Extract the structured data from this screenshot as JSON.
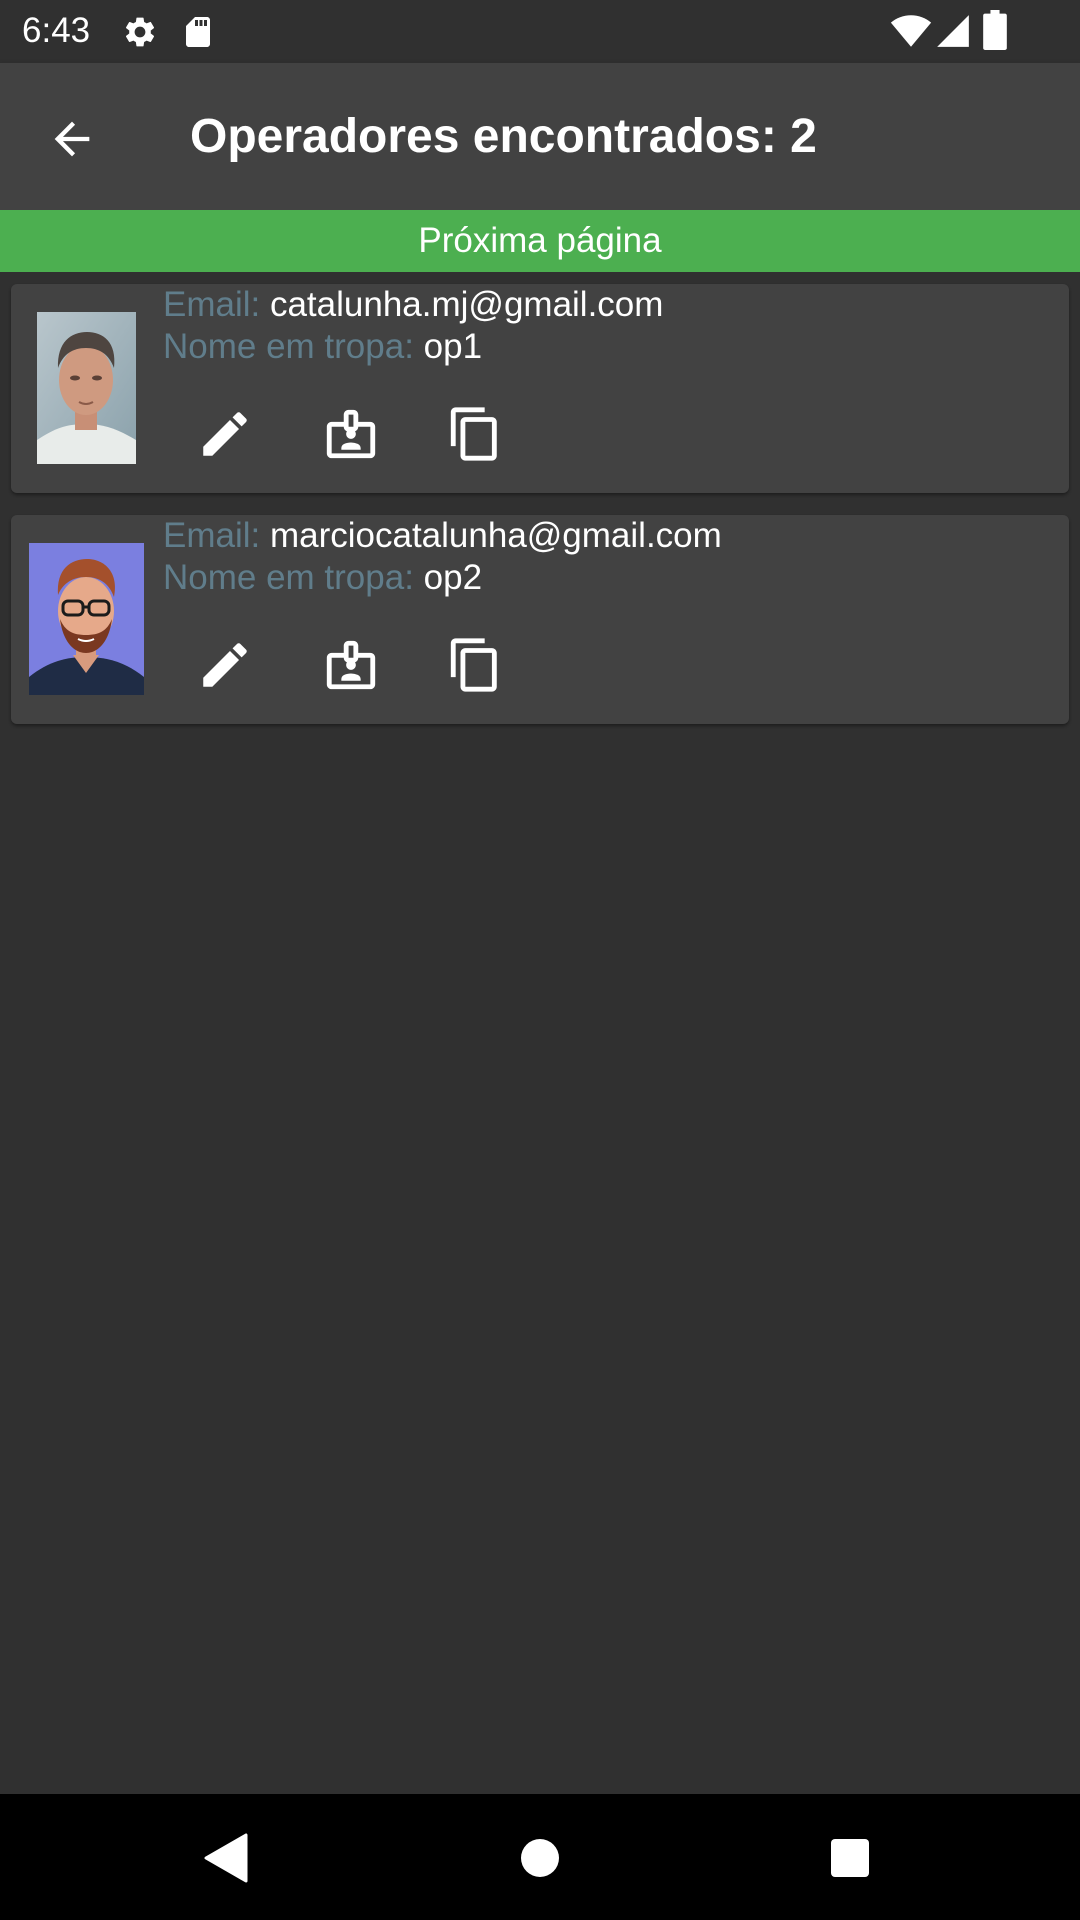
{
  "status_bar": {
    "time": "6:43",
    "icons": [
      "settings-icon",
      "sd-card-icon",
      "wifi-icon",
      "cell-signal-icon",
      "battery-icon"
    ]
  },
  "app_bar": {
    "back_icon": "arrow-back-icon",
    "title": "Operadores encontrados: 2"
  },
  "next_page": {
    "label": "Próxima página",
    "color": "#4caf50"
  },
  "operators": [
    {
      "email_label": "Email: ",
      "email": "catalunha.mj@gmail.com",
      "name_label": "Nome em tropa: ",
      "name": "op1",
      "avatar": "photo-avatar"
    },
    {
      "email_label": "Email: ",
      "email": "marciocatalunha@gmail.com",
      "name_label": "Nome em tropa: ",
      "name": "op2",
      "avatar": "cartoon-avatar"
    }
  ],
  "card_actions": [
    "edit-icon",
    "badge-icon",
    "copy-icon"
  ],
  "colors": {
    "background": "#303030",
    "app_bar": "#424242",
    "card": "#424242",
    "label": "#607d8b",
    "accent": "#4caf50"
  },
  "nav_bar": {
    "icons": [
      "back-triangle-icon",
      "home-circle-icon",
      "recents-square-icon"
    ]
  }
}
